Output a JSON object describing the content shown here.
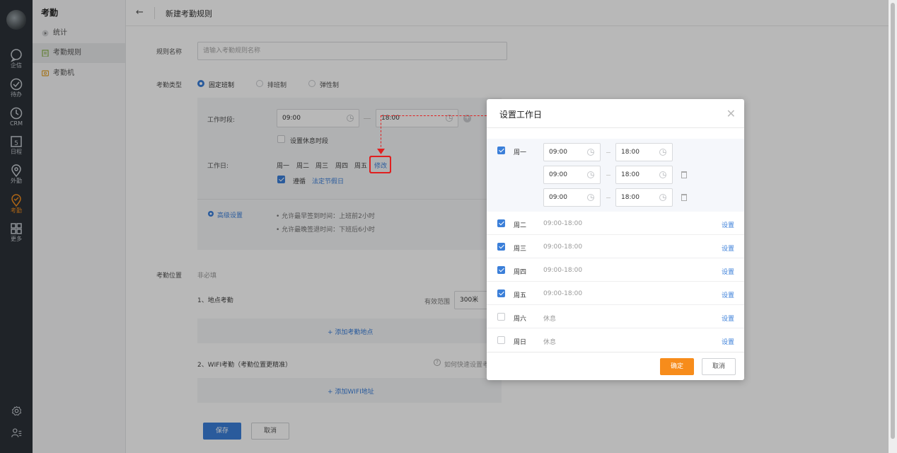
{
  "rail": {
    "items": [
      {
        "label": "企信",
        "icon": "chat-icon"
      },
      {
        "label": "待办",
        "icon": "check-circle-icon"
      },
      {
        "label": "CRM",
        "icon": "clock-icon"
      },
      {
        "label": "日程",
        "icon": "calendar-icon",
        "day": "5"
      },
      {
        "label": "外勤",
        "icon": "location-icon"
      },
      {
        "label": "考勤",
        "icon": "attendance-icon",
        "active": true
      },
      {
        "label": "更多",
        "icon": "grid-icon"
      }
    ]
  },
  "sidebar": {
    "title": "考勤",
    "items": [
      {
        "label": "统计",
        "icon": "triangle-right-icon"
      },
      {
        "label": "考勤规则",
        "icon": "clipboard-icon",
        "active": true
      },
      {
        "label": "考勤机",
        "icon": "device-icon"
      }
    ]
  },
  "header": {
    "back": "←",
    "title": "新建考勤规则"
  },
  "form": {
    "rule_name_label": "规则名称",
    "rule_name_placeholder": "请输入考勤规则名称",
    "type_label": "考勤类型",
    "types": [
      "固定班制",
      "排班制",
      "弹性制"
    ],
    "work_hours_label": "工作时段:",
    "start_time": "09:00",
    "end_time": "18:00",
    "rest_checkbox": "设置休息时段",
    "workdays_label": "工作日:",
    "workdays": [
      "周一",
      "周二",
      "周三",
      "周四",
      "周五"
    ],
    "modify_link": "修改",
    "holiday_check": "遵循",
    "holiday_link": "法定节假日",
    "advanced_link": "高级设置",
    "advanced_notes": [
      "允许最早签到时间：上班前2小时",
      "允许最晚签退时间：下班后6小时"
    ],
    "location_label": "考勤位置",
    "location_hint": "非必填",
    "place_title": "1、地点考勤",
    "range_label": "有效范围",
    "range_value": "300米",
    "add_place": "+ 添加考勤地点",
    "wifi_title": "2、WIFI考勤（考勤位置更精准）",
    "wifi_help": "如何快速设置考",
    "add_wifi": "+ 添加WIFI地址",
    "save": "保存",
    "cancel": "取消"
  },
  "modal": {
    "title": "设置工作日",
    "monday": {
      "name": "周一",
      "checked": true,
      "slots": [
        {
          "start": "09:00",
          "end": "18:00"
        },
        {
          "start": "09:00",
          "end": "18:00"
        },
        {
          "start": "09:00",
          "end": "18:00"
        }
      ]
    },
    "days": [
      {
        "name": "周二",
        "time": "09:00-18:00",
        "checked": true,
        "set": "设置"
      },
      {
        "name": "周三",
        "time": "09:00-18:00",
        "checked": true,
        "set": "设置"
      },
      {
        "name": "周四",
        "time": "09:00-18:00",
        "checked": true,
        "set": "设置"
      },
      {
        "name": "周五",
        "time": "09:00-18:00",
        "checked": true,
        "set": "设置"
      },
      {
        "name": "周六",
        "time": "休息",
        "checked": false,
        "set": "设置"
      },
      {
        "name": "周日",
        "time": "休息",
        "checked": false,
        "set": "设置"
      }
    ],
    "confirm": "确定",
    "cancel": "取消"
  },
  "colors": {
    "accent": "#3b7fd9",
    "active_nav": "#f08c1e",
    "confirm": "#f78c1b",
    "annotation": "#e02020"
  }
}
